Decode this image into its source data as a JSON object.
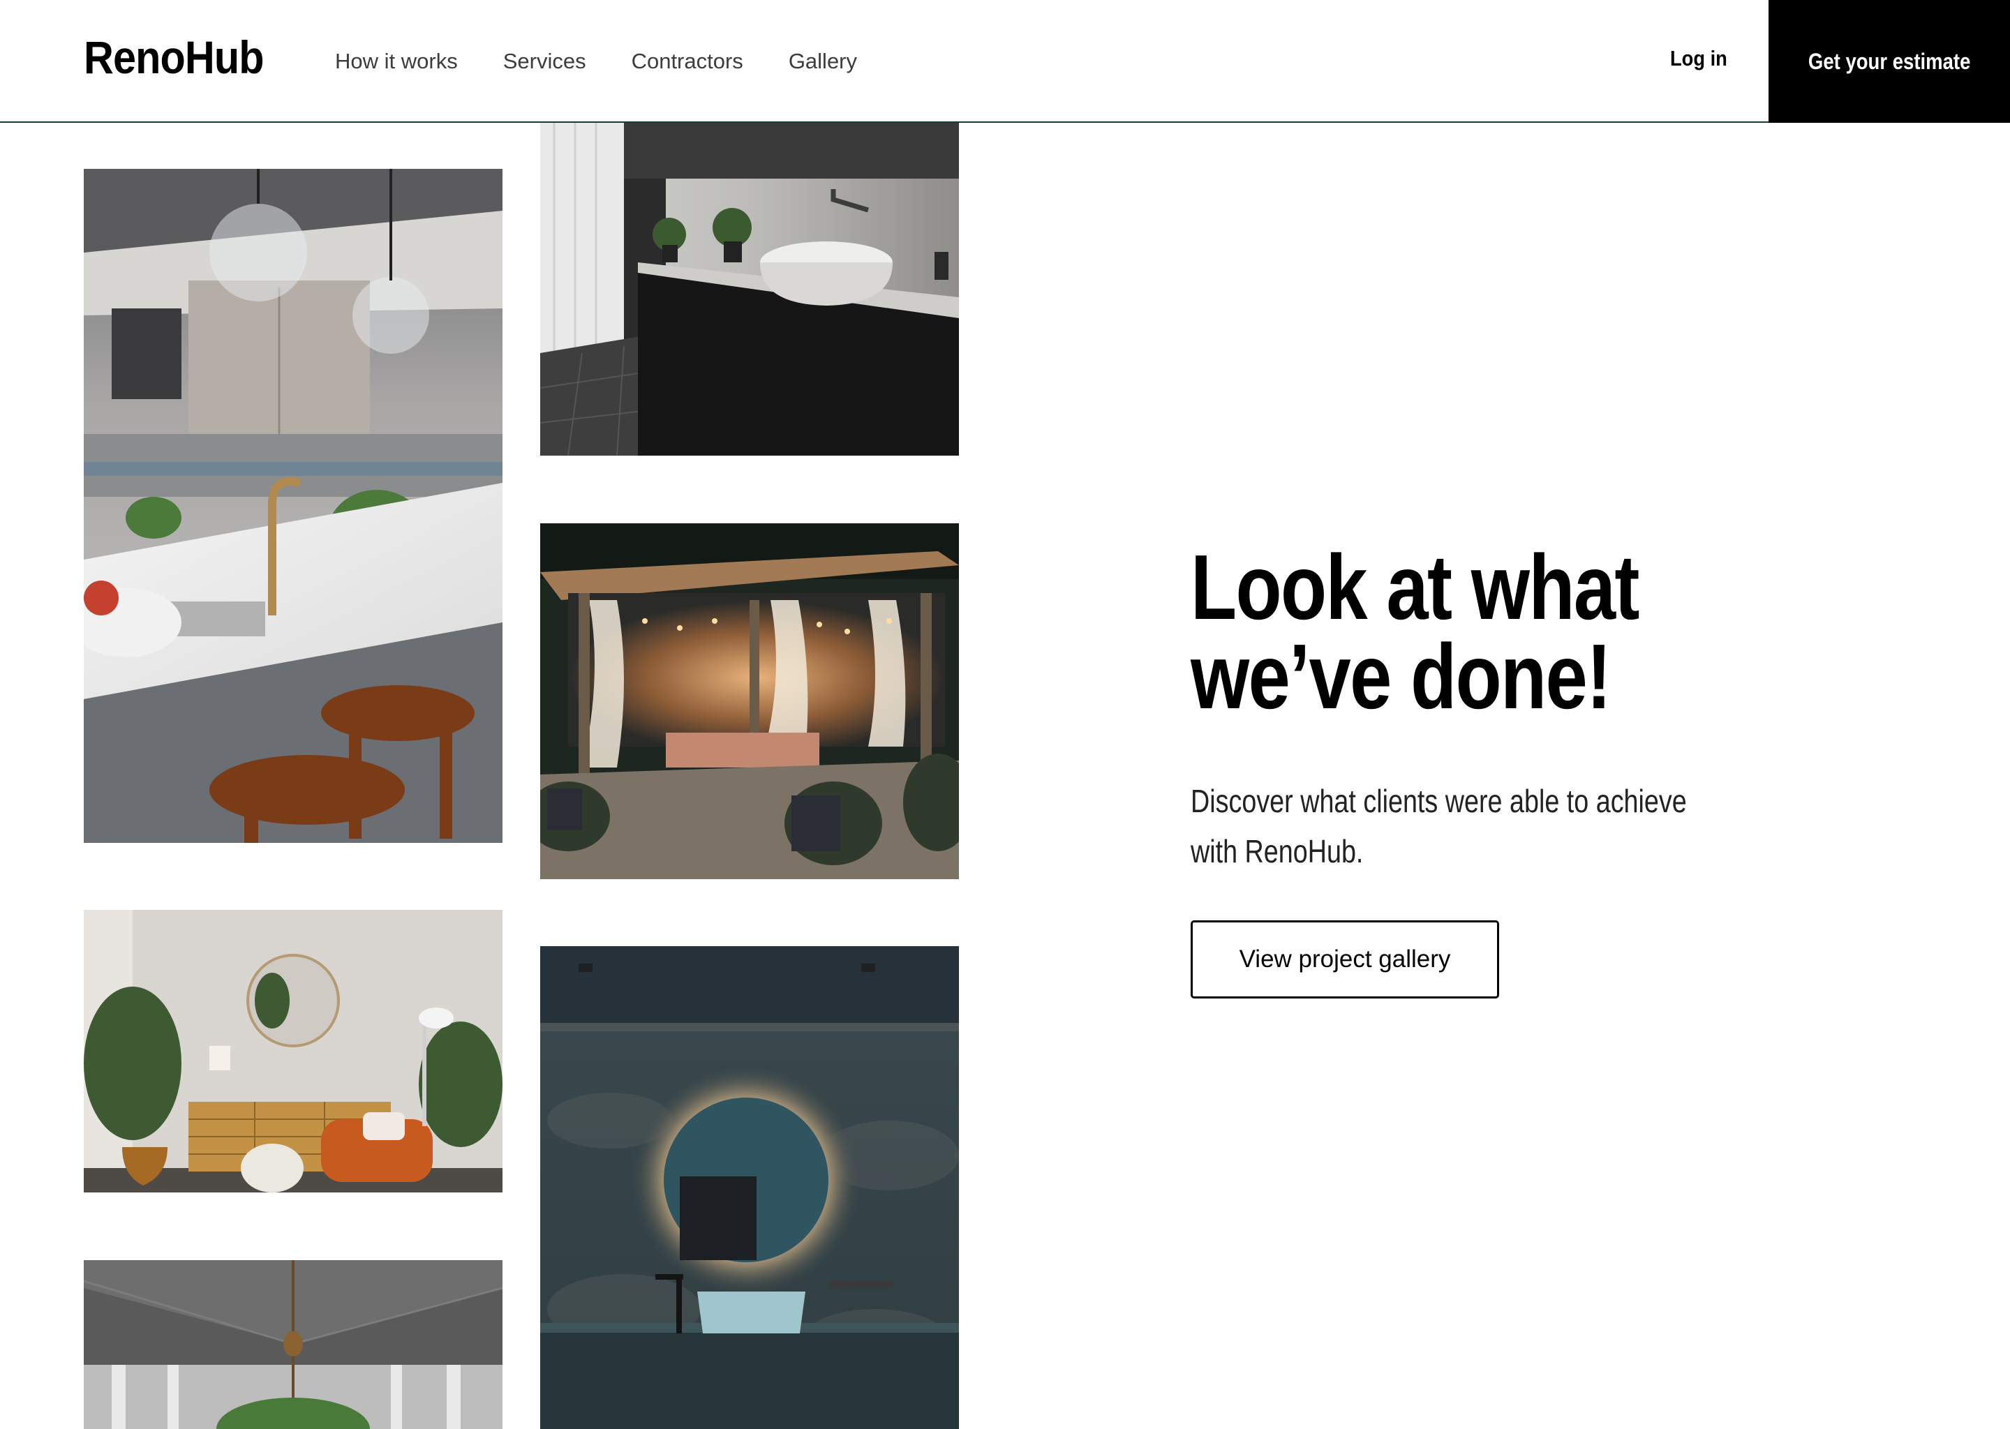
{
  "header": {
    "logo": "RenoHub",
    "nav": [
      "How it works",
      "Services",
      "Contractors",
      "Gallery"
    ],
    "login_label": "Log in",
    "cta_label": "Get your estimate"
  },
  "hero": {
    "headline_line1": "Look at what",
    "headline_line2": "we’ve done!",
    "subtext": "Discover what clients were able to achieve with RenoHub.",
    "button_label": "View project gallery"
  },
  "colors": {
    "background": "#ffffff",
    "cta_background": "#000000",
    "header_border": "#1f3d2e"
  }
}
